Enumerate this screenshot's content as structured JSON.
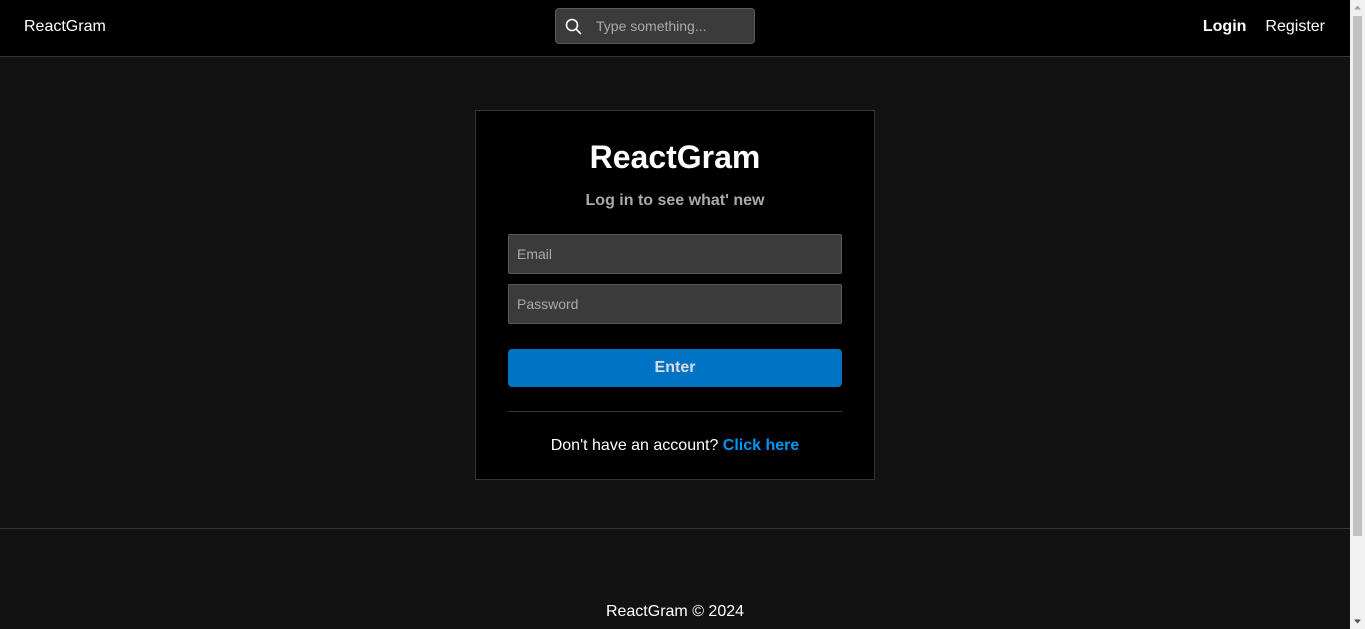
{
  "navbar": {
    "brand": "ReactGram",
    "search": {
      "placeholder": "Type something...",
      "value": "",
      "icon": "search-icon"
    },
    "links": {
      "login": "Login",
      "register": "Register"
    }
  },
  "login": {
    "title": "ReactGram",
    "subtitle": "Log in to see what' new",
    "email_placeholder": "Email",
    "password_placeholder": "Password",
    "submit_label": "Enter",
    "signup_prompt": "Don't have an account?",
    "signup_link": "Click here"
  },
  "footer": {
    "text": "ReactGram © 2024"
  },
  "colors": {
    "background": "#121212",
    "surface": "#000000",
    "primary": "#0073c5",
    "link": "#0095f6",
    "input_bg": "#3b3b3b"
  }
}
